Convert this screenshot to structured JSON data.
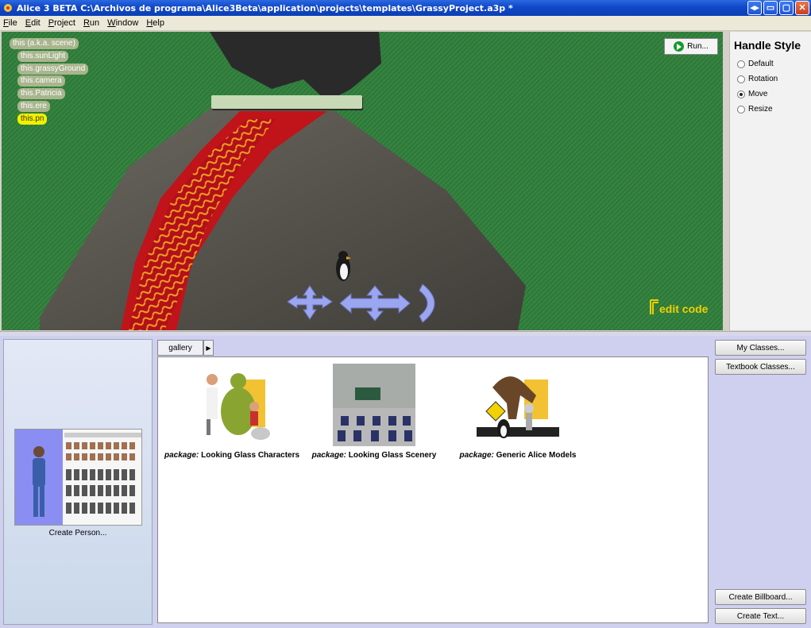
{
  "window": {
    "title": "Alice  3 BETA  C:\\Archivos de programa\\Alice3Beta\\application\\projects\\templates\\GrassyProject.a3p *",
    "buttons": [
      "◂▸",
      "▭",
      "▢",
      "✕"
    ]
  },
  "menu": [
    "File",
    "Edit",
    "Project",
    "Run",
    "Window",
    "Help"
  ],
  "scene": {
    "tree": [
      {
        "label": "this (a.k.a. scene)",
        "selected": false,
        "child": false
      },
      {
        "label": "this.sunLight",
        "selected": false,
        "child": true
      },
      {
        "label": "this.grassyGround",
        "selected": false,
        "child": true
      },
      {
        "label": "this.camera",
        "selected": false,
        "child": true
      },
      {
        "label": "this.Patricia",
        "selected": false,
        "child": true
      },
      {
        "label": "this.ere",
        "selected": false,
        "child": true
      },
      {
        "label": "this.pn",
        "selected": true,
        "child": true
      }
    ],
    "run_label": "Run...",
    "edit_code_label": "edit code",
    "colors": {
      "grass": "#2f7a3a",
      "lava": "#c0141a",
      "rock": "#5d5a52"
    }
  },
  "handle_style": {
    "title": "Handle Style",
    "options": [
      "Default",
      "Rotation",
      "Move",
      "Resize"
    ],
    "selected": "Move"
  },
  "gallery": {
    "tab_label": "gallery",
    "packages": [
      {
        "prefix": "package:",
        "name": "Looking Glass Characters",
        "icon": "characters-package-icon"
      },
      {
        "prefix": "package:",
        "name": "Looking Glass Scenery",
        "icon": "scenery-package-icon"
      },
      {
        "prefix": "package:",
        "name": "Generic Alice Models",
        "icon": "generic-models-package-icon"
      }
    ]
  },
  "person": {
    "caption": "Create Person..."
  },
  "side_buttons": {
    "my_classes": "My Classes...",
    "textbook_classes": "Textbook Classes...",
    "create_billboard": "Create Billboard...",
    "create_text": "Create Text..."
  }
}
